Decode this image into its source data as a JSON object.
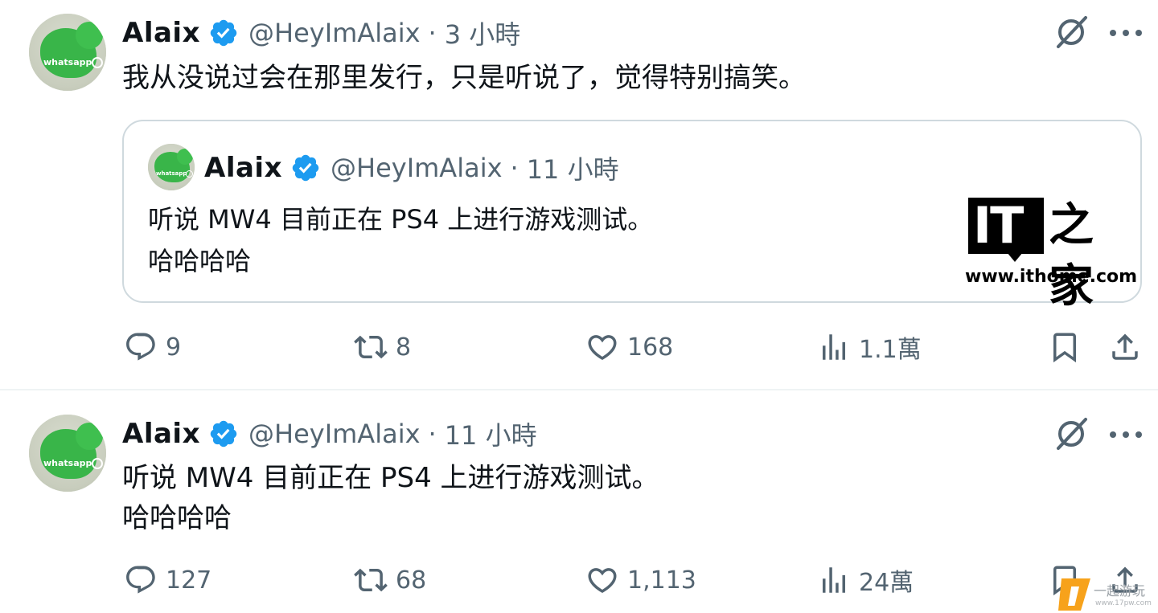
{
  "tweets": [
    {
      "author_name": "Alaix",
      "handle": "@HeyImAlaix",
      "separator": "·",
      "time": "3 小時",
      "text_lines": [
        "我从没说过会在那里发行，只是听说了，觉得特别搞笑。"
      ],
      "quoted": {
        "author_name": "Alaix",
        "handle": "@HeyImAlaix",
        "separator": "·",
        "time": "11 小時",
        "text_lines": [
          "听说 MW4 目前正在 PS4 上进行游戏测试。",
          "哈哈哈哈"
        ]
      },
      "stats": {
        "replies": "9",
        "reposts": "8",
        "likes": "168",
        "views": "1.1萬"
      }
    },
    {
      "author_name": "Alaix",
      "handle": "@HeyImAlaix",
      "separator": "·",
      "time": "11 小時",
      "text_lines": [
        "听说 MW4 目前正在 PS4 上进行游戏测试。",
        "哈哈哈哈"
      ],
      "stats": {
        "replies": "127",
        "reposts": "68",
        "likes": "1,113",
        "views": "24萬"
      }
    }
  ],
  "avatar": {
    "label": "whatsapp"
  },
  "icons": {
    "verified": "verified-badge-icon",
    "grok": "grok-icon",
    "more": "more-icon",
    "reply": "reply-icon",
    "repost": "repost-icon",
    "like": "like-icon",
    "views": "views-icon",
    "bookmark": "bookmark-icon",
    "share": "share-icon"
  },
  "watermark": {
    "it": "IT",
    "home": "之家",
    "url": "www.ithome.com"
  },
  "corner_watermark": {
    "text": "一起游玩",
    "sub": "www.17pw.com"
  },
  "colors": {
    "verified": "#1d9bf0",
    "secondary_text": "#536471",
    "border": "#cfd9de",
    "avatar_green": "#39b549"
  }
}
